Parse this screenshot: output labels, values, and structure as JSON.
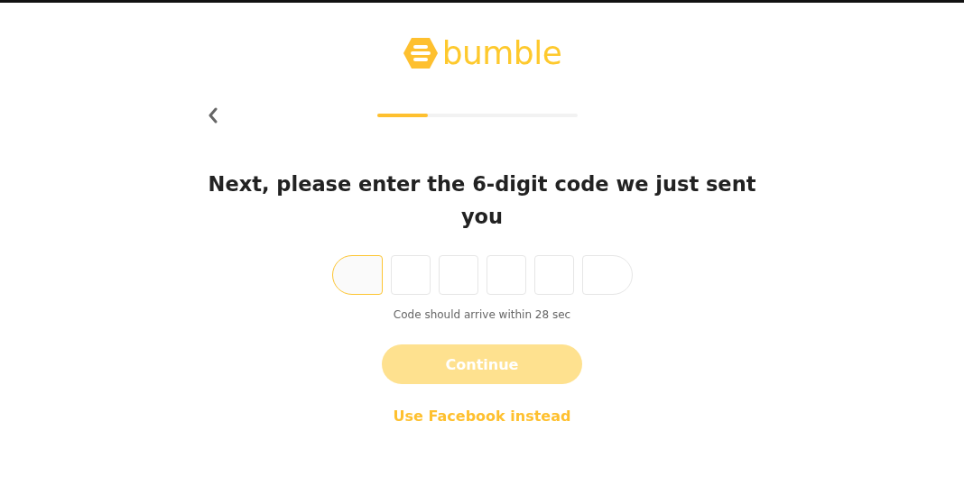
{
  "logo": {
    "text": "bumble"
  },
  "progress": {
    "level": 0.25
  },
  "heading": "Next, please enter the 6-digit code we just sent you",
  "code_boxes": [
    {
      "selected": true
    },
    {
      "selected": false
    },
    {
      "selected": false
    },
    {
      "selected": false
    },
    {
      "selected": false
    },
    {
      "selected": false
    }
  ],
  "hint": "Code should arrive within 28 sec",
  "continue_button": {
    "label": "Continue",
    "disabled": true
  },
  "facebook_link": "Use Facebook instead"
}
